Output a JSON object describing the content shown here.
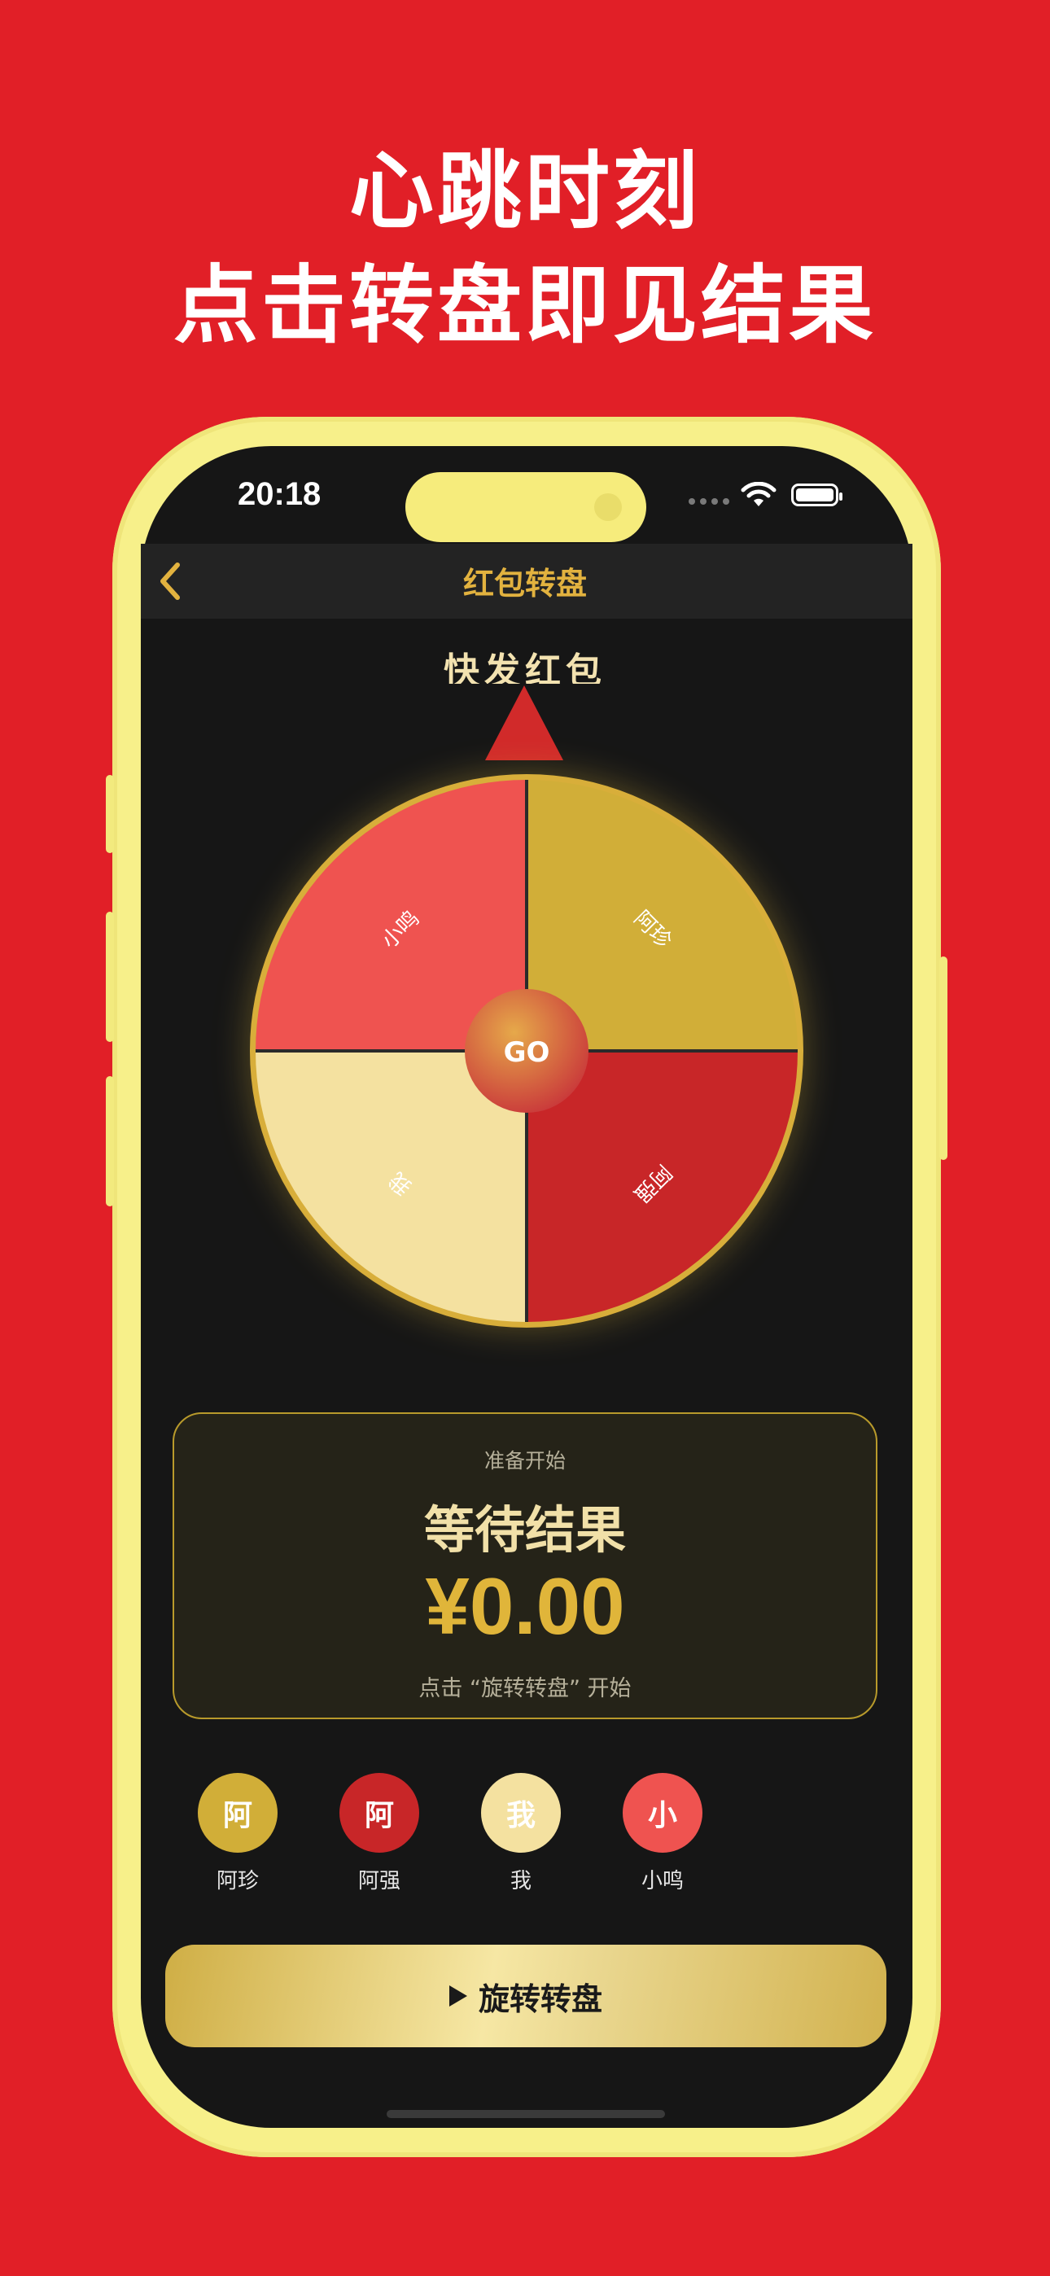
{
  "promo": {
    "line1": "心跳时刻",
    "line2": "点击转盘即见结果"
  },
  "status_bar": {
    "time": "20:18"
  },
  "navbar": {
    "title": "红包转盘"
  },
  "wheel": {
    "heading": "快发红包",
    "center_label": "GO",
    "segments": [
      {
        "label": "阿珍",
        "color": "#d1ae38"
      },
      {
        "label": "阿强",
        "color": "#c82628"
      },
      {
        "label": "我",
        "color": "#f4e1a0"
      },
      {
        "label": "小鸣",
        "color": "#ef5350"
      }
    ],
    "rim_color": "#d8ae3a"
  },
  "result": {
    "status": "准备开始",
    "title": "等待结果",
    "amount": "¥0.00",
    "hint": "点击 “旋转转盘” 开始"
  },
  "participants": [
    {
      "avatar": "阿",
      "name": "阿珍",
      "color": "#d1ae38",
      "text_color": "#ffffff"
    },
    {
      "avatar": "阿",
      "name": "阿强",
      "color": "#c82628",
      "text_color": "#ffffff"
    },
    {
      "avatar": "我",
      "name": "我",
      "color": "#f4e1a0",
      "text_color": "#ffffff"
    },
    {
      "avatar": "小",
      "name": "小鸣",
      "color": "#ef5350",
      "text_color": "#ffffff"
    }
  ],
  "spin_button": {
    "label": "旋转转盘"
  }
}
